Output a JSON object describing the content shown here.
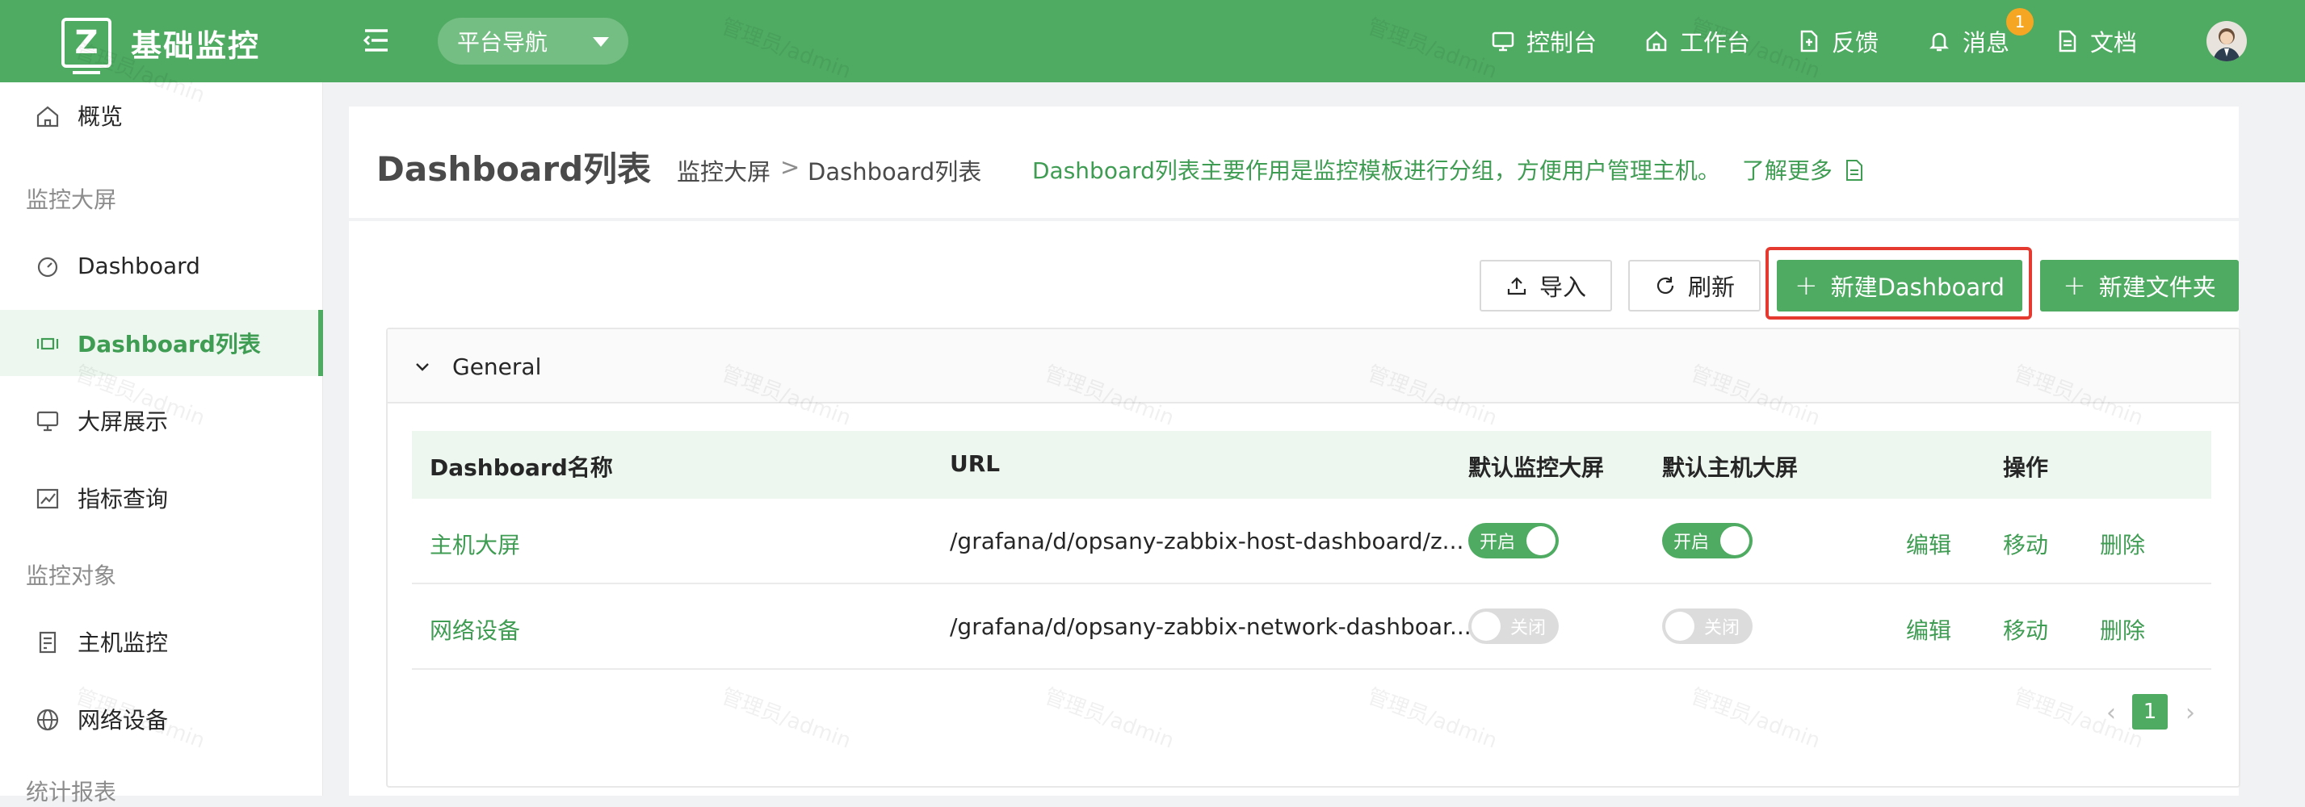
{
  "app": {
    "title": "基础监控",
    "logo_letter": "Z"
  },
  "topbar": {
    "platform_nav": "平台导航",
    "items": [
      {
        "label": "控制台",
        "icon": "monitor-icon"
      },
      {
        "label": "工作台",
        "icon": "home-icon"
      },
      {
        "label": "反馈",
        "icon": "feedback-icon"
      },
      {
        "label": "消息",
        "icon": "bell-icon",
        "badge": "1"
      },
      {
        "label": "文档",
        "icon": "document-icon"
      }
    ]
  },
  "sidebar": {
    "items": [
      {
        "label": "概览",
        "icon": "home-icon"
      },
      {
        "label": "Dashboard",
        "icon": "gauge-icon"
      },
      {
        "label": "Dashboard列表",
        "icon": "dashboard-list-icon"
      },
      {
        "label": "大屏展示",
        "icon": "monitor-icon"
      },
      {
        "label": "指标查询",
        "icon": "chart-icon"
      },
      {
        "label": "主机监控",
        "icon": "server-icon"
      },
      {
        "label": "网络设备",
        "icon": "globe-icon"
      }
    ],
    "groups": [
      "监控大屏",
      "监控对象",
      "统计报表"
    ]
  },
  "header": {
    "title": "Dashboard列表",
    "breadcrumb": [
      "监控大屏",
      ">",
      "Dashboard列表"
    ],
    "description": "Dashboard列表主要作用是监控模板进行分组，方便用户管理主机。",
    "learn_more": "了解更多"
  },
  "toolbar": {
    "import": "导入",
    "refresh": "刷新",
    "new_dashboard": "新建Dashboard",
    "new_folder": "新建文件夹"
  },
  "folder": {
    "name": "General"
  },
  "table": {
    "columns": [
      "Dashboard名称",
      "URL",
      "默认监控大屏",
      "默认主机大屏",
      "操作"
    ],
    "rows": [
      {
        "name": "主机大屏",
        "url": "/grafana/d/opsany-zabbix-host-dashboard/z...",
        "monitor_default": "开启",
        "host_default": "开启"
      },
      {
        "name": "网络设备",
        "url": "/grafana/d/opsany-zabbix-network-dashboar...",
        "monitor_default": "关闭",
        "host_default": "关闭"
      }
    ],
    "actions": [
      "编辑",
      "移动",
      "删除"
    ]
  },
  "pagination": {
    "current": "1"
  },
  "watermark": "管理员/admin",
  "colors": {
    "primary": "#4eab61",
    "highlight": "#e53a2f"
  }
}
